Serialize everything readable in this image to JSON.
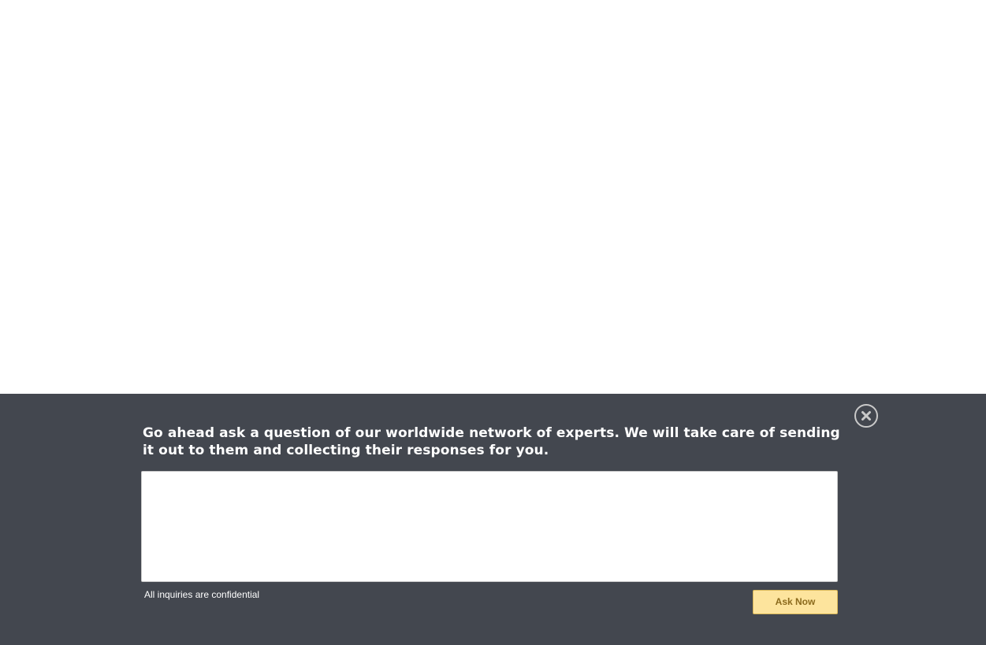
{
  "ask_panel": {
    "prompt": "Go ahead ask a question of our worldwide network of experts. We will take care of sending it out to them and collecting their responses for you.",
    "question_value": "",
    "confidential_note": "All inquiries are confidential",
    "submit_label": "Ask Now",
    "close_icon": "close-circle-icon"
  },
  "colors": {
    "panel_background": "#43474f",
    "button_background": "#fde49d",
    "button_text": "#8b6a1c",
    "close_icon": "#c9c9c9"
  }
}
